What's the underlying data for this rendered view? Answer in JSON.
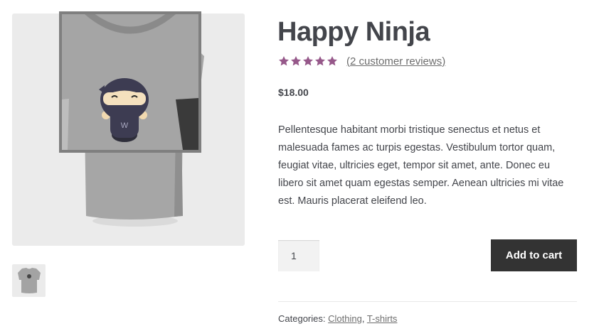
{
  "product": {
    "title": "Happy Ninja",
    "rating_value": 5,
    "rating_max": 5,
    "reviews_link": "(2 customer reviews)",
    "price": "$18.00",
    "description": "Pellentesque habitant morbi tristique senectus et netus et malesuada fames ac turpis egestas. Vestibulum tortor quam, feugiat vitae, ultricies eget, tempor sit amet, ante. Donec eu libero sit amet quam egestas semper. Aenean ultricies mi vitae est. Mauris placerat eleifend leo.",
    "quantity": "1",
    "add_to_cart_label": "Add to cart",
    "categories_label": "Categories:",
    "categories": [
      "Clothing",
      "T-shirts"
    ],
    "categories_separator": ", "
  },
  "colors": {
    "star": "#96588a",
    "button_bg": "#333333",
    "text": "#43454b",
    "link": "#6d6d6d"
  },
  "icons": {
    "star": "star-icon",
    "shirt": "ninja-tshirt-image"
  }
}
